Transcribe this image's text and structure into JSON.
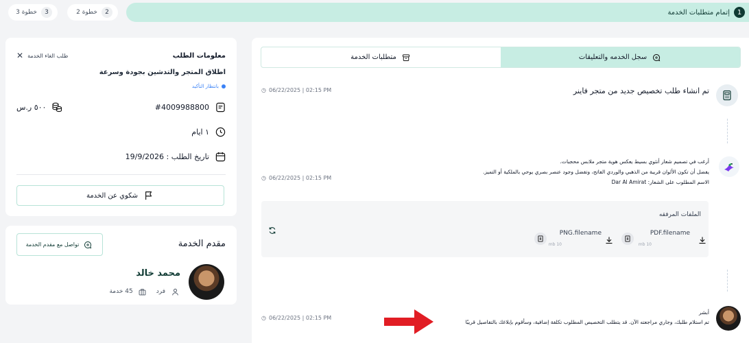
{
  "steps": {
    "active": {
      "num": "1",
      "label": "إتمام متطلبات الخدمة"
    },
    "step2": {
      "num": "2",
      "label": "خطوة 2"
    },
    "step3": {
      "num": "3",
      "label": "خطوة 3"
    }
  },
  "request": {
    "title": "معلومات الطلب",
    "cancel_label": "طلب الغاء الخدمة",
    "name": "اطلاق المتجر والتدشين بجودة وسرعة",
    "status": "بانتظار التأكيد",
    "order_id": "#4009988800",
    "price": "٥٠٠ ر.س",
    "duration": "١ ايام",
    "date": "تاريخ الطلب : 19/9/2026",
    "complain_label": "شكوي عن الخدمة"
  },
  "provider": {
    "title": "مقدم الخدمة",
    "contact_label": "تواصل مع مقدم الخدمة",
    "name": "محمد خالد",
    "type": "فرد",
    "services": "45 خدمة"
  },
  "main": {
    "tabs": [
      {
        "label": "سجل الخدمه والتعليقات",
        "active": true
      },
      {
        "label": "متطلبات الخدمة",
        "active": false
      }
    ],
    "events": [
      {
        "text": "تم انشاء طلب تخصيص جديد من متجر فاينر",
        "timestamp": "06/22/2025 | 02:15 PM"
      },
      {
        "lines": [
          "أرغب في تصميم شعار أنثوي بسيط يعكس هوية متجر ملابس محجبات.",
          "يفضل أن تكون الألوان قريبة من الذهبي والوردي الفاتح، وتفضل وجود عنصر بصري يوحي بالملكية أو التميز.",
          "الاسم المطلوب على الشعار: Dar Al Amirat"
        ],
        "timestamp": "06/22/2025 | 02:15 PM"
      },
      {
        "lines": [
          "أبشر",
          "تم استلام طلبك، وجاري مراجعته الآن. قد يتطلب التخصيص المطلوب تكلفة إضافية، وسأقوم بإبلاغك بالتفاصيل قريبًا"
        ],
        "timestamp": "06/22/2025 | 02:15 PM"
      }
    ],
    "attachments": {
      "title": "الملفات المرفقه",
      "files": [
        {
          "name": "PDF.filename",
          "size": "10 mb"
        },
        {
          "name": "PNG.filename",
          "size": "10 mb"
        }
      ]
    }
  },
  "colors": {
    "accent": "#c7ede3",
    "dark": "#0f3a33",
    "status": "#3b82f6",
    "arrow": "#e11d24"
  }
}
